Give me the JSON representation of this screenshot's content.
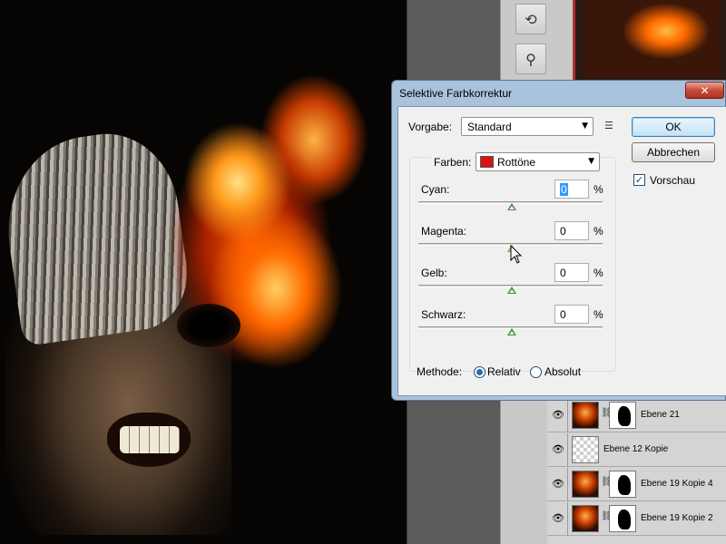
{
  "dialog": {
    "title": "Selektive Farbkorrektur",
    "close_label": "✕",
    "preset_label": "Vorgabe:",
    "preset_value": "Standard",
    "preset_menu_icon": "menu-list-icon",
    "ok_label": "OK",
    "cancel_label": "Abbrechen",
    "preview_label": "Vorschau",
    "preview_checked": true,
    "colors_label": "Farben:",
    "colors_value": "Rottöne",
    "colors_swatch": "#d81414",
    "sliders": [
      {
        "label": "Cyan:",
        "value": "0",
        "unit": "%",
        "selected": true
      },
      {
        "label": "Magenta:",
        "value": "0",
        "unit": "%",
        "selected": false
      },
      {
        "label": "Gelb:",
        "value": "0",
        "unit": "%",
        "selected": false
      },
      {
        "label": "Schwarz:",
        "value": "0",
        "unit": "%",
        "selected": false
      }
    ],
    "method_label": "Methode:",
    "method_options": [
      {
        "label": "Relativ",
        "checked": true
      },
      {
        "label": "Absolut",
        "checked": false
      }
    ]
  },
  "tools": [
    {
      "icon": "rotate-icon"
    },
    {
      "icon": "puppet-warp-icon"
    }
  ],
  "layers": [
    {
      "name": "Ebene 21",
      "thumb": "fire",
      "has_mask": true,
      "visible": true
    },
    {
      "name": "Ebene 12 Kopie",
      "thumb": "transparent",
      "has_mask": false,
      "visible": true
    },
    {
      "name": "Ebene 19 Kopie 4",
      "thumb": "fire",
      "has_mask": true,
      "visible": true
    },
    {
      "name": "Ebene 19 Kopie 2",
      "thumb": "fire",
      "has_mask": true,
      "visible": true
    }
  ],
  "glyphs": {
    "eye": "👁",
    "chain": "⛓",
    "dropdown": "▼",
    "check": "✓",
    "rotate": "⟲",
    "puppet": "⚲",
    "menu": "☰"
  }
}
